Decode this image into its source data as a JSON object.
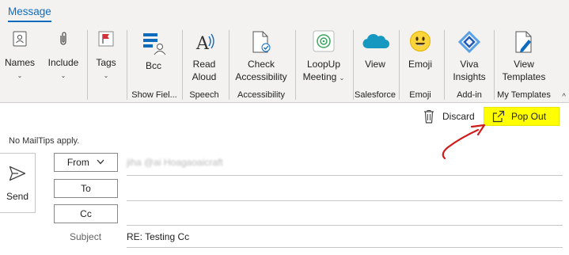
{
  "tabs": {
    "active": "Message"
  },
  "ribbon": {
    "names": {
      "label": "Names"
    },
    "include": {
      "label": "Include"
    },
    "tags": {
      "label": "Tags"
    },
    "bcc": {
      "label": "Bcc",
      "group": "Show Fiel..."
    },
    "read_aloud": {
      "label1": "Read",
      "label2": "Aloud",
      "group": "Speech"
    },
    "check_accessibility": {
      "label1": "Check",
      "label2": "Accessibility",
      "group": "Accessibility"
    },
    "loopup": {
      "label1": "LoopUp",
      "label2": "Meeting",
      "group": ""
    },
    "salesforce": {
      "label": "View",
      "group": "Salesforce"
    },
    "emoji": {
      "label": "Emoji",
      "group": "Emoji"
    },
    "viva": {
      "label1": "Viva",
      "label2": "Insights",
      "group": "Add-in"
    },
    "templates": {
      "label1": "View",
      "label2": "Templates",
      "group": "My Templates"
    },
    "chevron": "⌄",
    "collapse": "^"
  },
  "compose": {
    "discard_label": "Discard",
    "popout_label": "Pop Out",
    "mailtips": "No MailTips apply.",
    "send_label": "Send",
    "from_label": "From",
    "from_value": "jiha @ai Hoagaoaicraft",
    "to_label": "To",
    "cc_label": "Cc",
    "subject_label": "Subject",
    "subject_value": "RE: Testing Cc"
  },
  "colors": {
    "accent": "#0f6cbd",
    "highlight": "#ffff00",
    "annotation_arrow": "#d01c1c"
  }
}
